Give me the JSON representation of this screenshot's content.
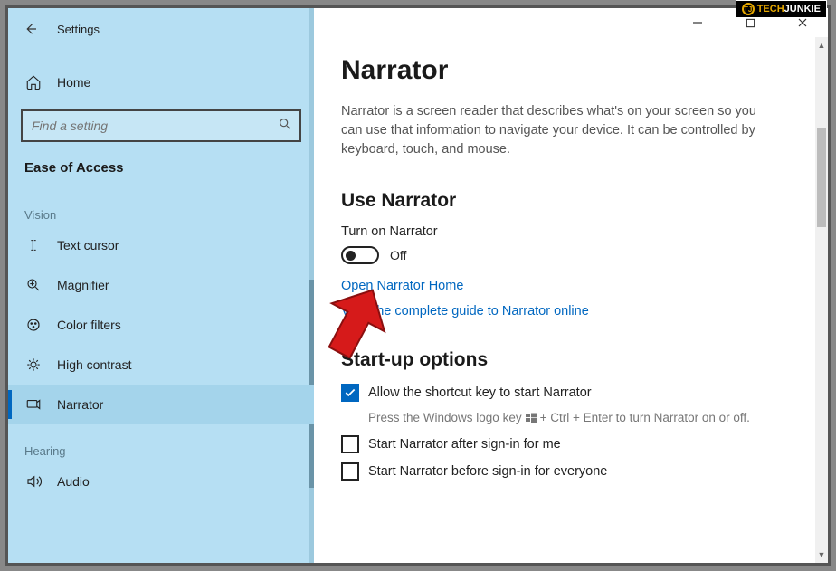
{
  "watermark": {
    "brand_prefix": "TECH",
    "brand_suffix": "JUNKIE",
    "icon_letter": "TJ"
  },
  "sidebar": {
    "back_tooltip": "Back",
    "app_title": "Settings",
    "home_label": "Home",
    "search_placeholder": "Find a setting",
    "section": "Ease of Access",
    "groups": [
      {
        "label": "Vision",
        "items": [
          {
            "icon": "text-cursor",
            "label": "Text cursor",
            "active": false
          },
          {
            "icon": "magnifier",
            "label": "Magnifier",
            "active": false
          },
          {
            "icon": "color-filters",
            "label": "Color filters",
            "active": false
          },
          {
            "icon": "high-contrast",
            "label": "High contrast",
            "active": false
          },
          {
            "icon": "narrator",
            "label": "Narrator",
            "active": true
          }
        ]
      },
      {
        "label": "Hearing",
        "items": [
          {
            "icon": "audio",
            "label": "Audio",
            "active": false
          }
        ]
      }
    ]
  },
  "main": {
    "title": "Narrator",
    "intro": "Narrator is a screen reader that describes what's on your screen so you can use that information to navigate your device. It can be controlled by keyboard, touch, and mouse.",
    "use_narrator_heading": "Use Narrator",
    "turn_on_label": "Turn on Narrator",
    "toggle_state": "Off",
    "link_home": "Open Narrator Home",
    "link_guide": "View the complete guide to Narrator online",
    "startup_heading": "Start-up options",
    "opt_shortcut": "Allow the shortcut key to start Narrator",
    "opt_shortcut_hint_pre": "Press the Windows logo key ",
    "opt_shortcut_hint_post": " + Ctrl + Enter to turn Narrator on or off.",
    "opt_after_signin": "Start Narrator after sign-in for me",
    "opt_before_signin": "Start Narrator before sign-in for everyone"
  },
  "window_controls": {
    "minimize": "Minimize",
    "maximize": "Maximize",
    "close": "Close"
  }
}
